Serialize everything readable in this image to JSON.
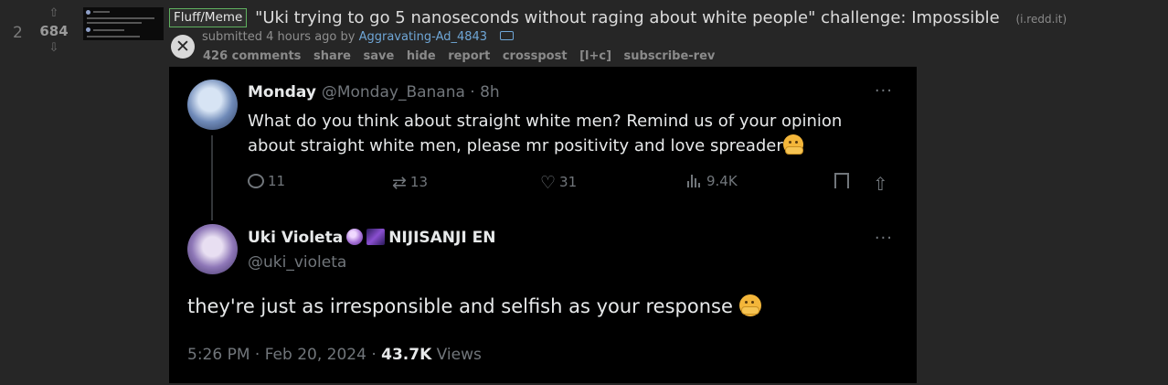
{
  "post": {
    "rank": "2",
    "score": "684",
    "flair": "Fluff/Meme",
    "title": "\"Uki trying to go 5 nanoseconds without raging about white people\" challenge: Impossible",
    "domain": "(i.redd.it)",
    "submitted_prefix": "submitted 4 hours ago by",
    "author": "Aggravating-Ad_4843",
    "buttons": [
      "426 comments",
      "share",
      "save",
      "hide",
      "report",
      "crosspost",
      "[l+c]",
      "subscribe-rev"
    ]
  },
  "tweet": {
    "reply": {
      "name": "Monday",
      "handle": "@Monday_Banana · 8h",
      "text": "What do you think about straight white men? Remind us of your opinion about straight white men, please mr positivity and love spreader",
      "replies": "11",
      "retweets": "13",
      "likes": "31",
      "views": "9.4K"
    },
    "main": {
      "name": "Uki Violeta",
      "affiliation": "NIJISANJI EN",
      "handle": "@uki_violeta",
      "text": "they're just as irresponsible and selfish as your response",
      "time": "5:26 PM · Feb 20, 2024 · ",
      "views_count": "43.7K",
      "views_label": " Views"
    },
    "more": "···"
  },
  "icons": {
    "upvote": "upvote-arrow-icon",
    "downvote": "downvote-arrow-icon",
    "close": "close-icon",
    "tag": "tag-icon"
  }
}
